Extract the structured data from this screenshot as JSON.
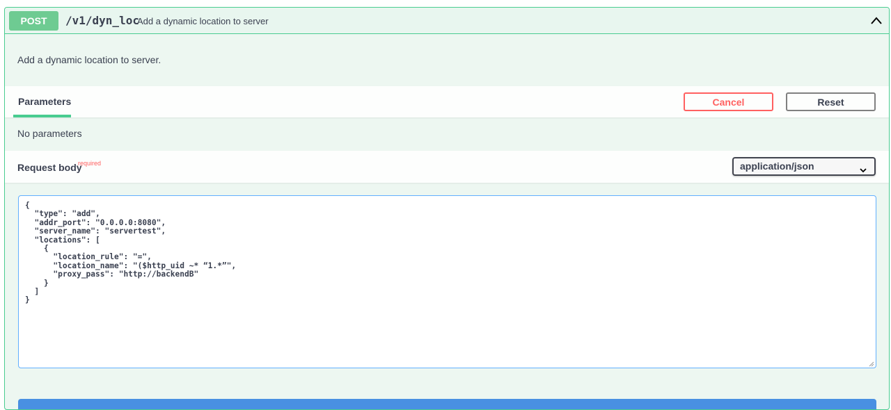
{
  "operation": {
    "method": "POST",
    "path": "/v1/dyn_loc",
    "summary": "Add a dynamic location to server",
    "description": "Add a dynamic location to server."
  },
  "parameters": {
    "tab_label": "Parameters",
    "cancel_label": "Cancel",
    "reset_label": "Reset",
    "empty_text": "No parameters"
  },
  "request_body": {
    "title": "Request body",
    "required_label": "required",
    "content_type": "application/json",
    "value": "{\n  \"type\": \"add\",\n  \"addr_port\": \"0.0.0.0:8080\",\n  \"server_name\": \"servertest\",\n  \"locations\": [\n    {\n      \"location_rule\": \"=\",\n      \"location_name\": \"($http_uid ~* “1.*”\",\n      \"proxy_pass\": \"http://backendB\"\n    }\n  ]\n}"
  },
  "colors": {
    "post_green": "#49cc90",
    "cancel_red": "#ff6060",
    "execute_blue": "#4990e2"
  },
  "icons": {
    "collapse": "chevron-up-icon",
    "select": "chevron-down-icon"
  }
}
